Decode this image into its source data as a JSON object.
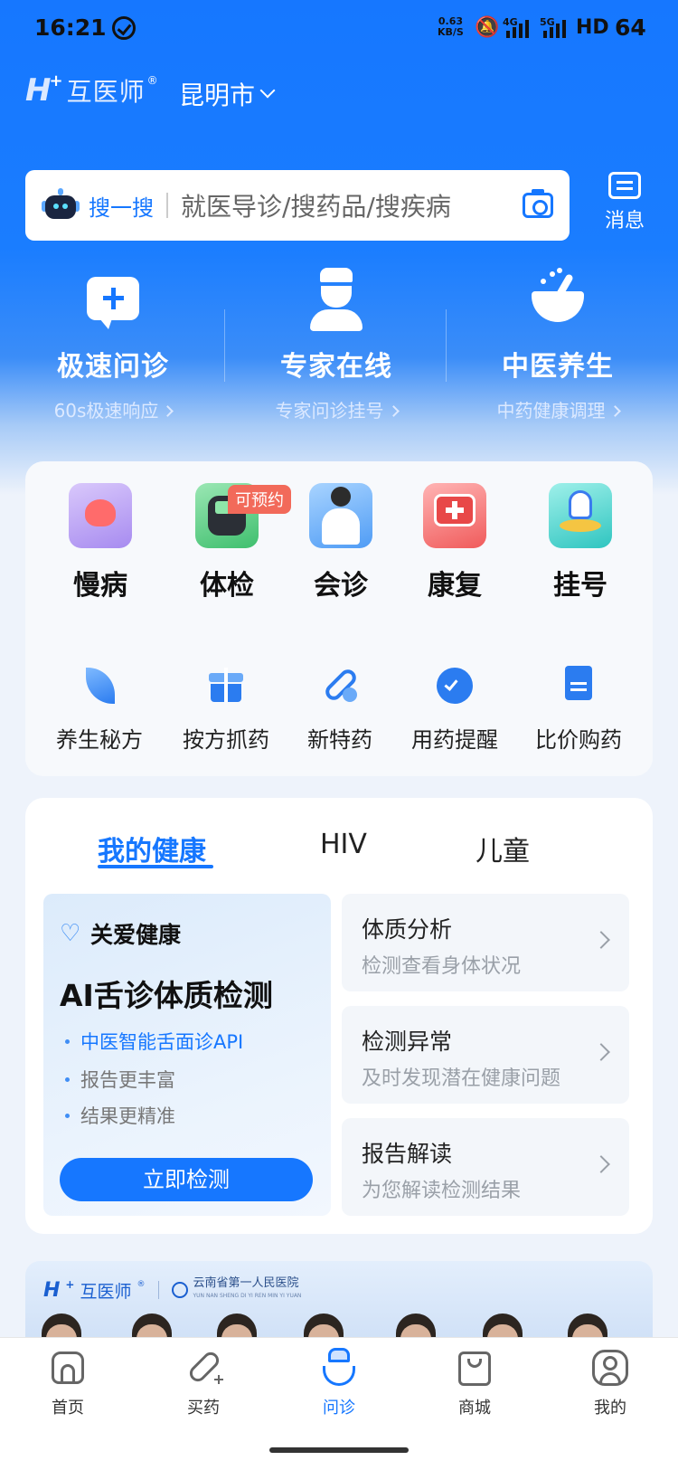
{
  "status_bar": {
    "time": "16:21",
    "net_speed_value": "0.63",
    "net_speed_unit": "KB/S",
    "signal_1": "4G",
    "signal_2": "5G",
    "hd": "HD",
    "battery": "64"
  },
  "header": {
    "logo_mark": "H",
    "logo_plus": "+",
    "logo_name": "互医师",
    "logo_reg": "®",
    "city": "昆明市"
  },
  "search": {
    "label": "搜一搜",
    "placeholder": "就医导诊/搜药品/搜疾病"
  },
  "message": {
    "label": "消息"
  },
  "quick_services": [
    {
      "title": "极速问诊",
      "subtitle": "60s极速响应"
    },
    {
      "title": "专家在线",
      "subtitle": "专家问诊挂号"
    },
    {
      "title": "中医养生",
      "subtitle": "中药健康调理"
    }
  ],
  "main_grid": [
    {
      "label": "慢病",
      "icon": "heart-hand-icon"
    },
    {
      "label": "体检",
      "icon": "blood-pressure-icon"
    },
    {
      "label": "会诊",
      "icon": "doctor-icon"
    },
    {
      "label": "康复",
      "icon": "first-aid-icon"
    },
    {
      "label": "挂号",
      "icon": "registration-icon"
    }
  ],
  "tag_label": "可预约",
  "secondary_grid": [
    {
      "label": "养生秘方",
      "icon": "leaf-icon"
    },
    {
      "label": "按方抓药",
      "icon": "gift-box-icon"
    },
    {
      "label": "新特药",
      "icon": "pill-icon"
    },
    {
      "label": "用药提醒",
      "icon": "alarm-clock-icon"
    },
    {
      "label": "比价购药",
      "icon": "price-tag-icon"
    }
  ],
  "health": {
    "tabs": [
      "我的健康",
      "HIV",
      "儿童"
    ],
    "promo_heading": "关爱健康",
    "promo_title": "AI舌诊体质检测",
    "bullets": [
      "中医智能舌面诊API",
      "报告更丰富",
      "结果更精准"
    ],
    "cta": "立即检测",
    "features": [
      {
        "title": "体质分析",
        "subtitle": "检测查看身体状况"
      },
      {
        "title": "检测异常",
        "subtitle": "及时发现潜在健康问题"
      },
      {
        "title": "报告解读",
        "subtitle": "为您解读检测结果"
      }
    ]
  },
  "banner": {
    "logo_mark": "H",
    "logo_plus": "+",
    "logo_name": "互医师",
    "logo_reg": "®",
    "hospital": "云南省第一人民医院",
    "hospital_pinyin": "YUN NAN SHENG DI YI REN MIN YI YUAN"
  },
  "bottom_nav": [
    {
      "label": "首页",
      "icon": "home-icon"
    },
    {
      "label": "买药",
      "icon": "pill-icon"
    },
    {
      "label": "问诊",
      "icon": "doctor-icon"
    },
    {
      "label": "商城",
      "icon": "shopping-bag-icon"
    },
    {
      "label": "我的",
      "icon": "profile-icon"
    }
  ],
  "colors": {
    "brand": "#1677ff",
    "tag_red": "#f26a5a",
    "muted": "#9aa0a8"
  }
}
